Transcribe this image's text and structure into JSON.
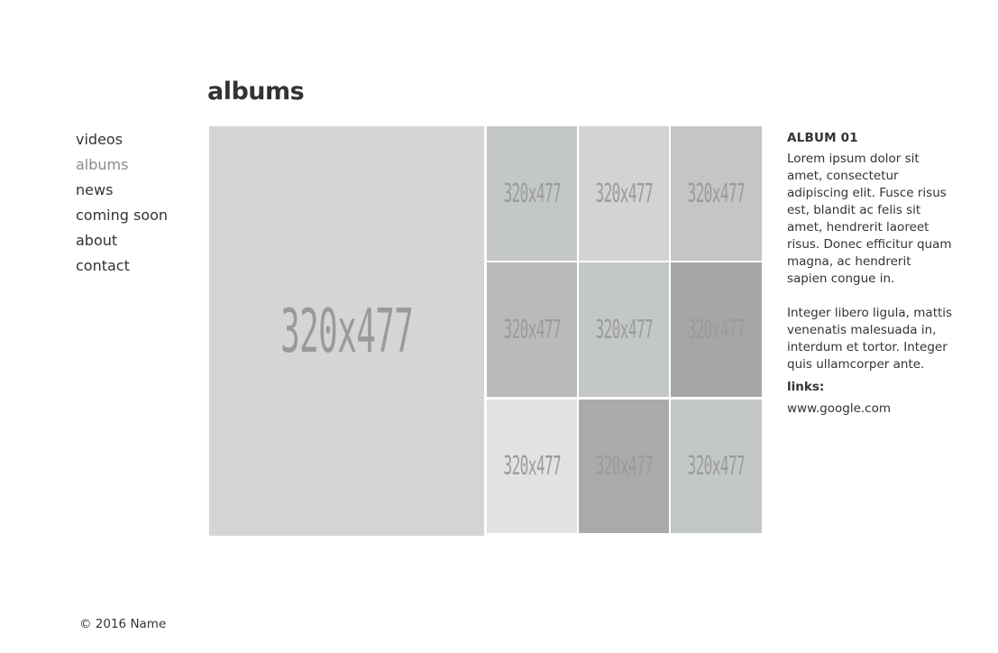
{
  "page": {
    "title": "albums"
  },
  "nav": {
    "items": [
      {
        "label": "videos",
        "active": false
      },
      {
        "label": "albums",
        "active": true
      },
      {
        "label": "news",
        "active": false
      },
      {
        "label": "coming soon",
        "active": false
      },
      {
        "label": "about",
        "active": false
      },
      {
        "label": "contact",
        "active": false
      }
    ]
  },
  "gallery": {
    "featured": {
      "label": "320x477",
      "color": "#d5d5d5"
    },
    "thumbnails": [
      {
        "label": "320x477",
        "color": "#c4c7c7"
      },
      {
        "label": "320x477",
        "color": "#d2d3d5"
      },
      {
        "label": "320x477",
        "color": "#c4c5c4"
      },
      {
        "label": "320x477",
        "color": "#b9bab9"
      },
      {
        "label": "320x477",
        "color": "#c4c7c8"
      },
      {
        "label": "320x477",
        "color": "#a5a6a7"
      },
      {
        "label": "320x477",
        "color": "#e1e3e2"
      },
      {
        "label": "320x477",
        "color": "#a9aaab"
      },
      {
        "label": "320x477",
        "color": "#c4c7c8"
      }
    ]
  },
  "album": {
    "title": "ALBUM 01",
    "paragraph1": "Lorem ipsum dolor sit amet, consectetur adipiscing elit. Fusce risus est, blandit ac felis sit amet, hendrerit laoreet risus. Donec efficitur quam magna, ac hendrerit sapien congue in.",
    "paragraph2": "Integer libero ligula, mattis venenatis malesuada in, interdum et tortor. Integer quis ullamcorper ante.",
    "links_label": "links:",
    "link": "www.google.com"
  },
  "footer": {
    "copyright": "© 2016 Name"
  }
}
